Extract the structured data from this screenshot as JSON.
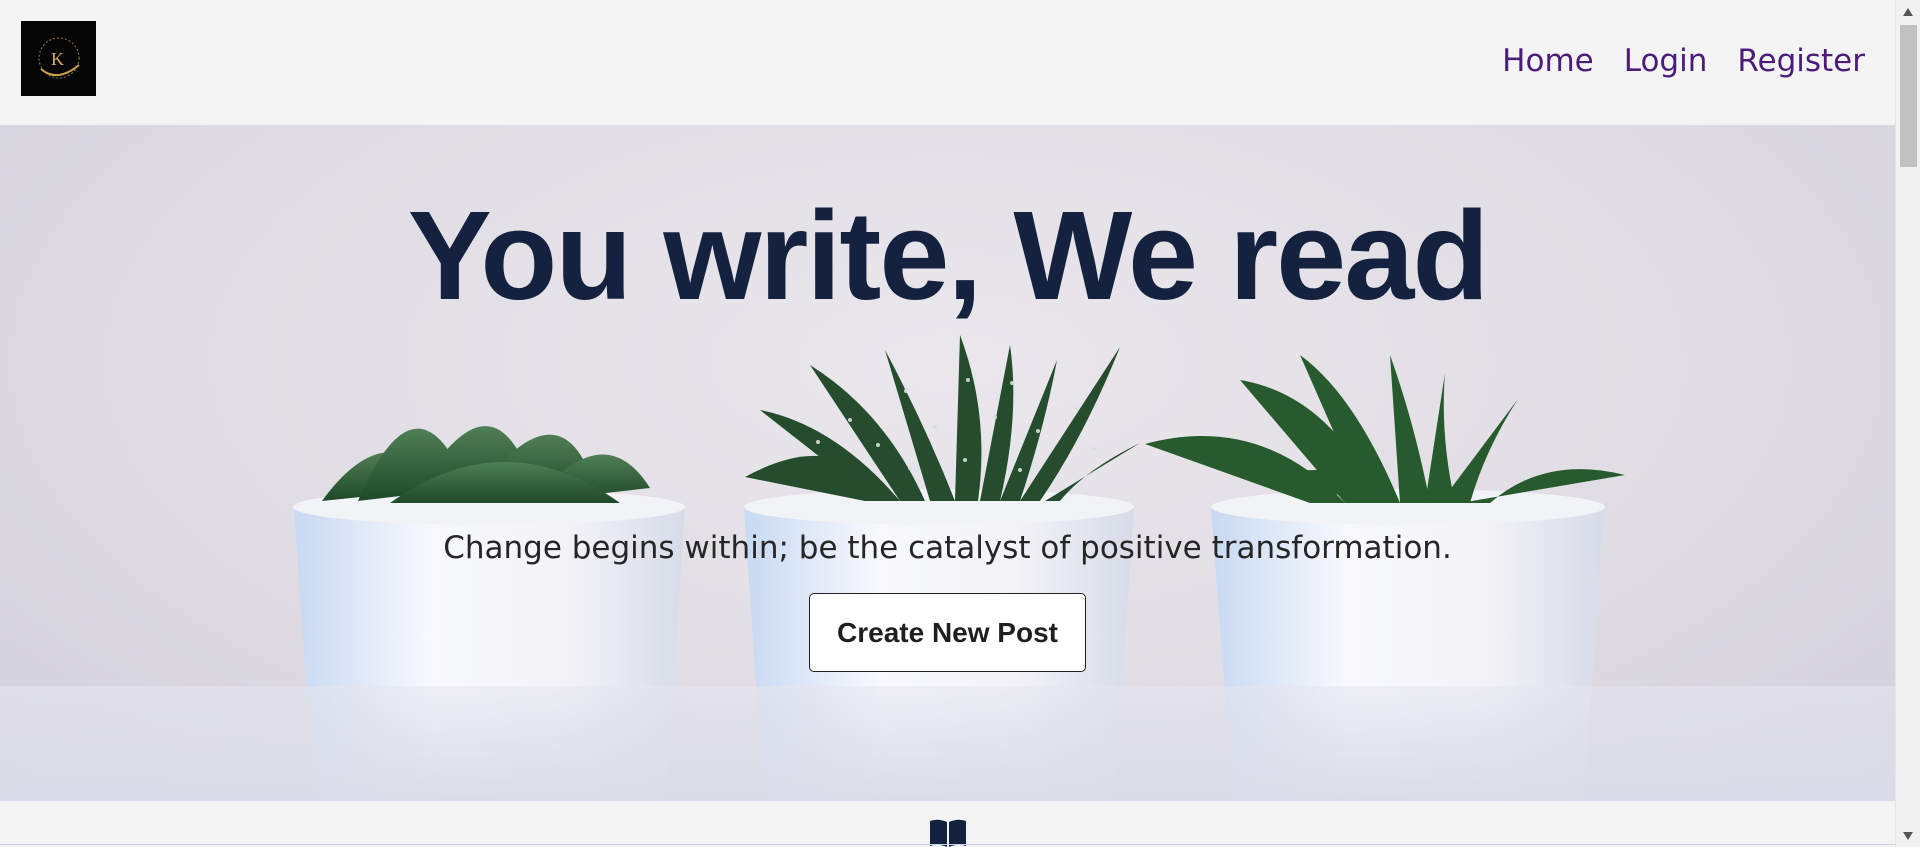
{
  "navbar": {
    "logo_text": "K",
    "links": [
      {
        "label": "Home"
      },
      {
        "label": "Login"
      },
      {
        "label": "Register"
      }
    ]
  },
  "hero": {
    "title": "You write, We read",
    "subtitle": "Change begins within; be the catalyst of positive transformation.",
    "cta_label": "Create New Post"
  },
  "footer": {
    "icon": "book-icon"
  },
  "colors": {
    "nav_link": "#4b1d7a",
    "hero_title": "#15223f",
    "logo_background": "#060606",
    "page_background": "#f4f4f4"
  }
}
